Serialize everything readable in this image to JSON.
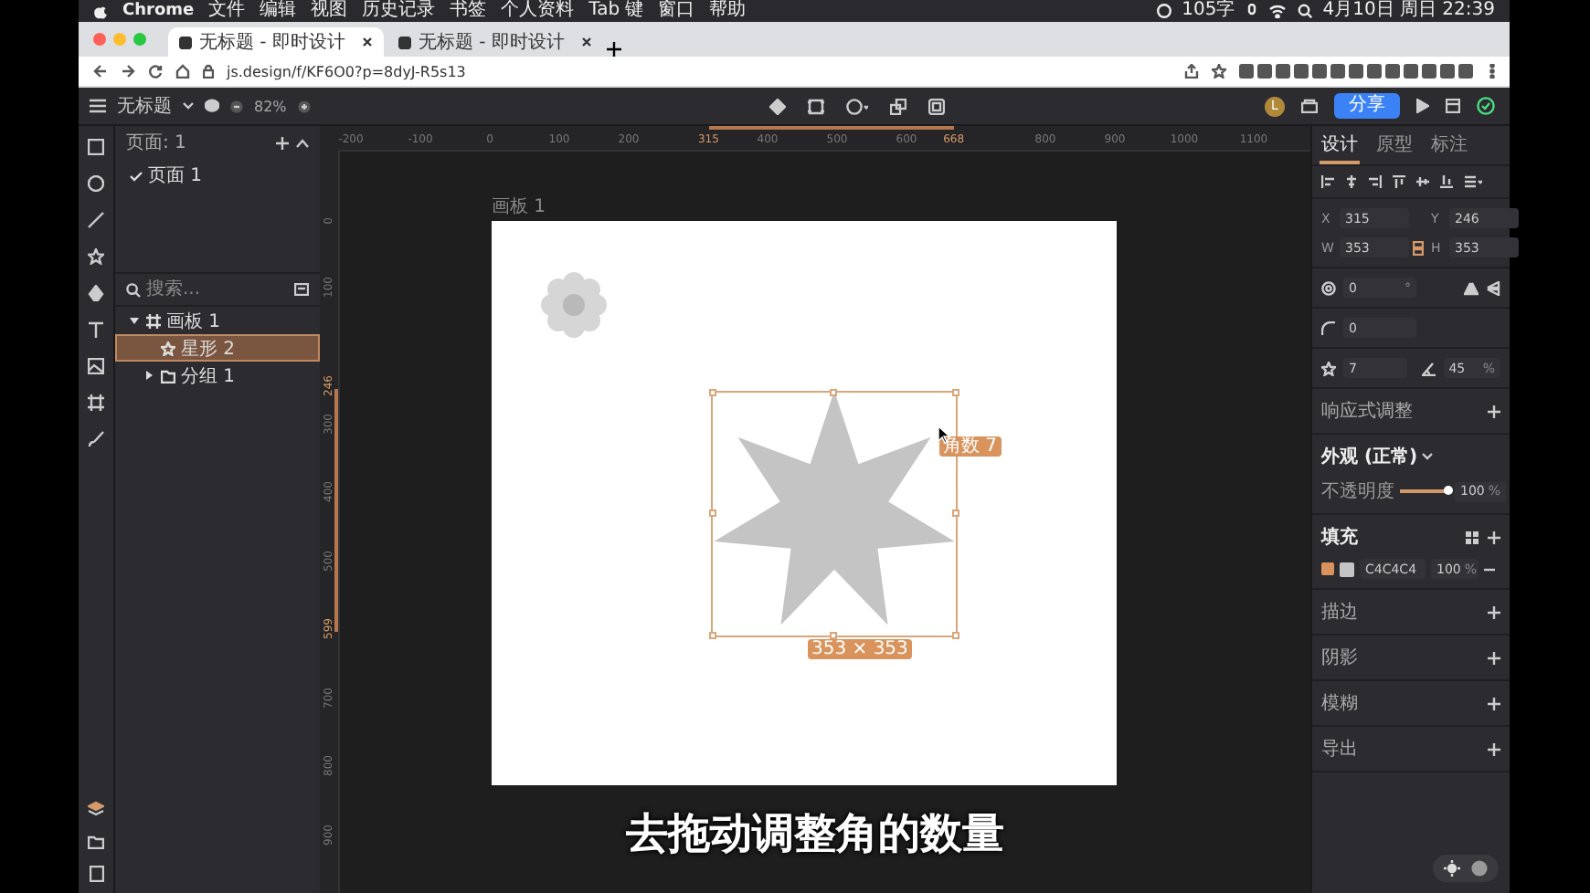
{
  "menubar": {
    "app": "Chrome",
    "items": [
      "文件",
      "编辑",
      "视图",
      "历史记录",
      "书签",
      "个人资料",
      "Tab 键",
      "窗口",
      "帮助"
    ],
    "word_count": "105字",
    "clock": "4月10日 周日 22:39"
  },
  "browser_tabs": [
    {
      "title": "无标题 - 即时设计",
      "selected": true
    },
    {
      "title": "无标题 - 即时设计",
      "selected": false
    }
  ],
  "address": "js.design/f/KF6O0?p=8dyJ-R5s13",
  "toolbar": {
    "file_name": "无标题",
    "zoom": "82%",
    "avatar": "L",
    "share": "分享"
  },
  "pages": {
    "header": "页面: 1",
    "items": [
      {
        "name": "页面 1",
        "selected": true
      }
    ]
  },
  "layer_search": {
    "placeholder": "搜索..."
  },
  "layers": [
    {
      "name": "画板 1",
      "kind": "frame",
      "expanded": true,
      "selected": false,
      "children": [
        {
          "name": "星形 2",
          "kind": "star",
          "selected": true
        },
        {
          "name": "分组 1",
          "kind": "group",
          "expanded": false,
          "selected": false
        }
      ]
    }
  ],
  "canvas": {
    "ruler_x": [
      {
        "label": "-200",
        "highlighted": false
      },
      {
        "label": "-100",
        "highlighted": false
      },
      {
        "label": "0",
        "highlighted": false
      },
      {
        "label": "100",
        "highlighted": false
      },
      {
        "label": "200",
        "highlighted": false
      },
      {
        "label": "315",
        "highlighted": true
      },
      {
        "label": "400",
        "highlighted": false
      },
      {
        "label": "500",
        "highlighted": false
      },
      {
        "label": "600",
        "highlighted": false
      },
      {
        "label": "668",
        "highlighted": true
      },
      {
        "label": "800",
        "highlighted": false
      },
      {
        "label": "900",
        "highlighted": false
      },
      {
        "label": "1000",
        "highlighted": false
      },
      {
        "label": "1100",
        "highlighted": false
      }
    ],
    "ruler_y": [
      {
        "label": "0",
        "highlighted": false
      },
      {
        "label": "100",
        "highlighted": false
      },
      {
        "label": "246",
        "highlighted": true
      },
      {
        "label": "300",
        "highlighted": false
      },
      {
        "label": "400",
        "highlighted": false
      },
      {
        "label": "500",
        "highlighted": false
      },
      {
        "label": "599",
        "highlighted": true
      },
      {
        "label": "700",
        "highlighted": false
      },
      {
        "label": "800",
        "highlighted": false
      },
      {
        "label": "900",
        "highlighted": false
      }
    ],
    "artboard_title": "画板 1",
    "handle_tooltip": "角数 7",
    "size_label": "353 × 353",
    "subtitle": "去拖动调整角的数量"
  },
  "inspector": {
    "tabs": [
      {
        "label": "设计",
        "selected": true
      },
      {
        "label": "原型",
        "selected": false
      },
      {
        "label": "标注",
        "selected": false
      }
    ],
    "position": [
      {
        "label": "X",
        "value": "315"
      },
      {
        "label": "Y",
        "value": "246"
      },
      {
        "label": "W",
        "value": "353"
      },
      {
        "label": "H",
        "value": "353"
      }
    ],
    "rotation": {
      "value": "0",
      "unit": "°"
    },
    "corner_radius": {
      "value": "0"
    },
    "star": {
      "points": "7",
      "ratio": "45",
      "unit": "%"
    },
    "responsive": {
      "label": "响应式调整"
    },
    "appearance": {
      "label": "外观 (正常)",
      "opacity_label": "不透明度",
      "level": 1,
      "value": "100",
      "unit": "%"
    },
    "fill": {
      "label": "填充",
      "items": [
        {
          "checked": true,
          "color": "#c4c4c4",
          "hex": "C4C4C4",
          "opacity": "100",
          "unit": "%"
        }
      ]
    },
    "sections": [
      "描边",
      "阴影",
      "模糊",
      "导出"
    ]
  }
}
